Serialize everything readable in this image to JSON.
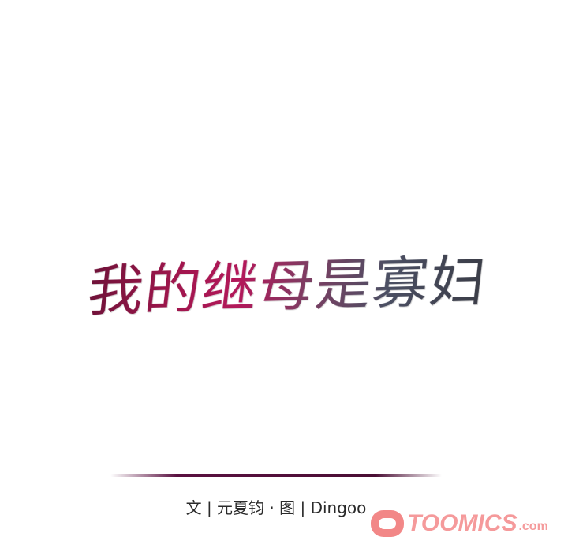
{
  "title": "我的继母是寡妇",
  "credits": "文 | 元夏钧 · 图 | Dingoo",
  "logo": {
    "brand": "TOOMICS",
    "suffix": ".com",
    "color": "#f2797a"
  },
  "colors": {
    "title_start": "#a0164d",
    "title_end": "#3a3c46",
    "divider": "#4a0e34"
  }
}
